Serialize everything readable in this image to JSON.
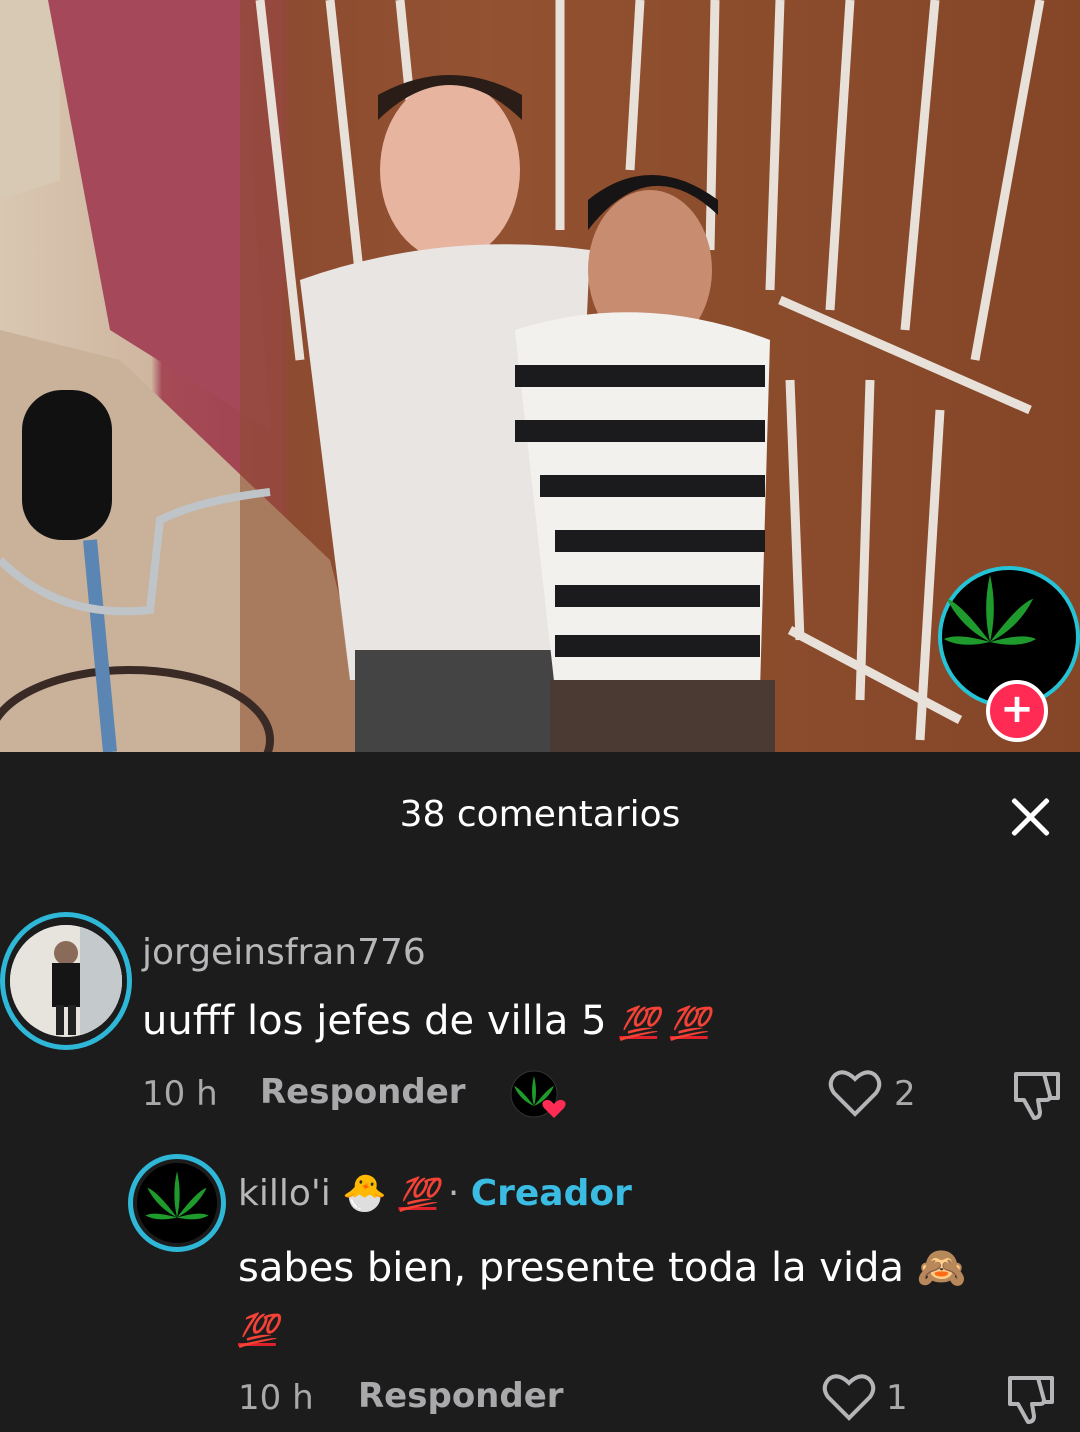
{
  "panel": {
    "title": "38 comentarios"
  },
  "comments": [
    {
      "username": "jorgeinsfran776",
      "text": "uufff los jefes de villa 5",
      "emoji": [
        "💯",
        "💯"
      ],
      "time": "10 h",
      "reply_label": "Responder",
      "likes": "2"
    }
  ],
  "reply": {
    "username": "killo'i",
    "username_emoji": [
      "🐣",
      "💯"
    ],
    "separator": "·",
    "creator_label": "Creador",
    "text": "sabes bien, presente toda la vida",
    "text_emoji": [
      "🙈",
      "💯"
    ],
    "time": "10 h",
    "reply_label": "Responder",
    "likes": "1"
  },
  "colors": {
    "background": "#1c1c1d",
    "accent_ring": "#2fb7d8",
    "creator": "#3bbce3",
    "follow": "#ff2b55"
  },
  "icons": [
    "leaf-icon",
    "plus-icon",
    "close-icon",
    "heart-icon",
    "dislike-icon"
  ]
}
